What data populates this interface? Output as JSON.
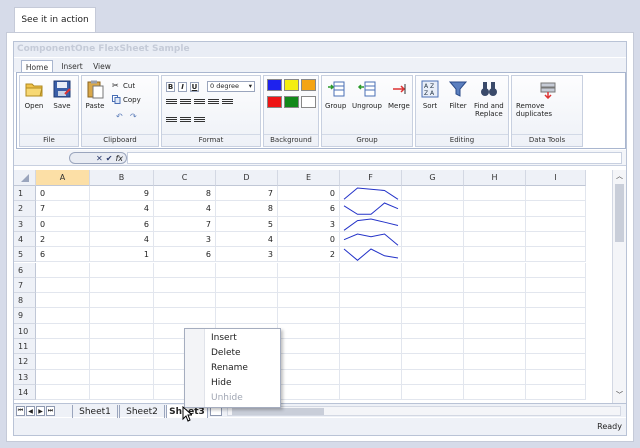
{
  "page": {
    "tab_label": "See it in action"
  },
  "app": {
    "title": "ComponentOne FlexSheet Sample"
  },
  "ribbon": {
    "tabs": [
      "Home",
      "Insert",
      "View"
    ],
    "active_tab": "Home",
    "groups": {
      "file": {
        "label": "File",
        "open": "Open",
        "save": "Save"
      },
      "clipboard": {
        "label": "Clipboard",
        "paste": "Paste",
        "cut": "Cut",
        "copy": "Copy"
      },
      "format": {
        "label": "Format",
        "bold": "B",
        "italic": "I",
        "underline": "U",
        "rotation": "0 degree"
      },
      "background": {
        "label": "Background",
        "colors": [
          "#1e22ee",
          "#f4ee10",
          "#f4a414",
          "#ee1414",
          "#12881a",
          "#ffffff"
        ]
      },
      "group": {
        "label": "Group",
        "group_btn": "Group",
        "ungroup_btn": "Ungroup",
        "merge_btn": "Merge"
      },
      "editing": {
        "label": "Editing",
        "sort": "Sort",
        "filter": "Filter",
        "find_replace_line1": "Find and",
        "find_replace_line2": "Replace"
      },
      "data_tools": {
        "label": "Data Tools",
        "remove_duplicates": "Remove duplicates"
      }
    }
  },
  "formula_bar": {
    "cancel": "✕",
    "confirm": "✔",
    "fx": "fx",
    "value": ""
  },
  "grid": {
    "columns": [
      "A",
      "B",
      "C",
      "D",
      "E",
      "F",
      "G",
      "H",
      "I"
    ],
    "selected_column": "A",
    "row_numbers": [
      "1",
      "2",
      "3",
      "4",
      "5",
      "6",
      "7",
      "8",
      "9",
      "10",
      "11",
      "12",
      "13",
      "14"
    ],
    "rows": [
      [
        "0",
        "9",
        "8",
        "7",
        "0"
      ],
      [
        "7",
        "4",
        "4",
        "8",
        "6"
      ],
      [
        "0",
        "6",
        "7",
        "5",
        "3"
      ],
      [
        "2",
        "4",
        "3",
        "4",
        "0"
      ],
      [
        "6",
        "1",
        "6",
        "3",
        "2"
      ]
    ],
    "sparkline_color": "#2332c8"
  },
  "sheets": {
    "tabs": [
      "Sheet1",
      "Sheet2",
      "Sheet3"
    ],
    "active": "Sheet3"
  },
  "context_menu": {
    "items": [
      {
        "label": "Insert",
        "enabled": true
      },
      {
        "label": "Delete",
        "enabled": true
      },
      {
        "label": "Rename",
        "enabled": true
      },
      {
        "label": "Hide",
        "enabled": true
      },
      {
        "label": "Unhide",
        "enabled": false
      }
    ]
  },
  "status": {
    "text": "Ready"
  }
}
